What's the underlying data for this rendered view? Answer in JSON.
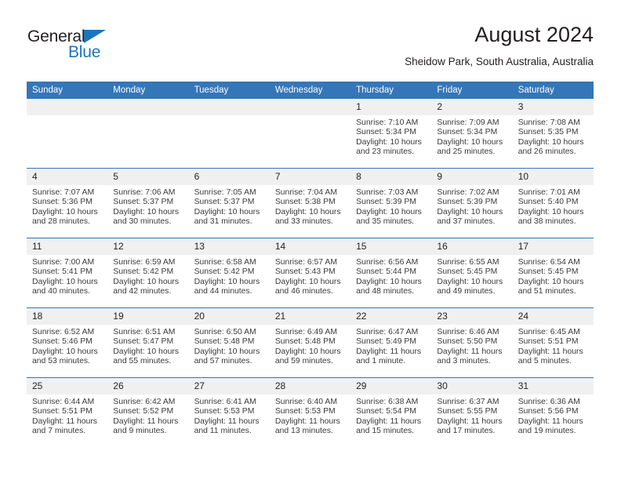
{
  "brand": {
    "name_dark": "General",
    "name_blue": "Blue",
    "accent_color": "#1b75bc"
  },
  "header": {
    "title": "August 2024",
    "subtitle": "Sheidow Park, South Australia, Australia"
  },
  "theme": {
    "header_band": "#3576b8",
    "daynum_band": "#f0f0f0",
    "text": "#231f20"
  },
  "weekday_headers": [
    "Sunday",
    "Monday",
    "Tuesday",
    "Wednesday",
    "Thursday",
    "Friday",
    "Saturday"
  ],
  "weeks": [
    [
      {
        "day": "",
        "blank": true
      },
      {
        "day": "",
        "blank": true
      },
      {
        "day": "",
        "blank": true
      },
      {
        "day": "",
        "blank": true
      },
      {
        "day": "1",
        "sunrise": "Sunrise: 7:10 AM",
        "sunset": "Sunset: 5:34 PM",
        "daylight": "Daylight: 10 hours and 23 minutes."
      },
      {
        "day": "2",
        "sunrise": "Sunrise: 7:09 AM",
        "sunset": "Sunset: 5:34 PM",
        "daylight": "Daylight: 10 hours and 25 minutes."
      },
      {
        "day": "3",
        "sunrise": "Sunrise: 7:08 AM",
        "sunset": "Sunset: 5:35 PM",
        "daylight": "Daylight: 10 hours and 26 minutes."
      }
    ],
    [
      {
        "day": "4",
        "sunrise": "Sunrise: 7:07 AM",
        "sunset": "Sunset: 5:36 PM",
        "daylight": "Daylight: 10 hours and 28 minutes."
      },
      {
        "day": "5",
        "sunrise": "Sunrise: 7:06 AM",
        "sunset": "Sunset: 5:37 PM",
        "daylight": "Daylight: 10 hours and 30 minutes."
      },
      {
        "day": "6",
        "sunrise": "Sunrise: 7:05 AM",
        "sunset": "Sunset: 5:37 PM",
        "daylight": "Daylight: 10 hours and 31 minutes."
      },
      {
        "day": "7",
        "sunrise": "Sunrise: 7:04 AM",
        "sunset": "Sunset: 5:38 PM",
        "daylight": "Daylight: 10 hours and 33 minutes."
      },
      {
        "day": "8",
        "sunrise": "Sunrise: 7:03 AM",
        "sunset": "Sunset: 5:39 PM",
        "daylight": "Daylight: 10 hours and 35 minutes."
      },
      {
        "day": "9",
        "sunrise": "Sunrise: 7:02 AM",
        "sunset": "Sunset: 5:39 PM",
        "daylight": "Daylight: 10 hours and 37 minutes."
      },
      {
        "day": "10",
        "sunrise": "Sunrise: 7:01 AM",
        "sunset": "Sunset: 5:40 PM",
        "daylight": "Daylight: 10 hours and 38 minutes."
      }
    ],
    [
      {
        "day": "11",
        "sunrise": "Sunrise: 7:00 AM",
        "sunset": "Sunset: 5:41 PM",
        "daylight": "Daylight: 10 hours and 40 minutes."
      },
      {
        "day": "12",
        "sunrise": "Sunrise: 6:59 AM",
        "sunset": "Sunset: 5:42 PM",
        "daylight": "Daylight: 10 hours and 42 minutes."
      },
      {
        "day": "13",
        "sunrise": "Sunrise: 6:58 AM",
        "sunset": "Sunset: 5:42 PM",
        "daylight": "Daylight: 10 hours and 44 minutes."
      },
      {
        "day": "14",
        "sunrise": "Sunrise: 6:57 AM",
        "sunset": "Sunset: 5:43 PM",
        "daylight": "Daylight: 10 hours and 46 minutes."
      },
      {
        "day": "15",
        "sunrise": "Sunrise: 6:56 AM",
        "sunset": "Sunset: 5:44 PM",
        "daylight": "Daylight: 10 hours and 48 minutes."
      },
      {
        "day": "16",
        "sunrise": "Sunrise: 6:55 AM",
        "sunset": "Sunset: 5:45 PM",
        "daylight": "Daylight: 10 hours and 49 minutes."
      },
      {
        "day": "17",
        "sunrise": "Sunrise: 6:54 AM",
        "sunset": "Sunset: 5:45 PM",
        "daylight": "Daylight: 10 hours and 51 minutes."
      }
    ],
    [
      {
        "day": "18",
        "sunrise": "Sunrise: 6:52 AM",
        "sunset": "Sunset: 5:46 PM",
        "daylight": "Daylight: 10 hours and 53 minutes."
      },
      {
        "day": "19",
        "sunrise": "Sunrise: 6:51 AM",
        "sunset": "Sunset: 5:47 PM",
        "daylight": "Daylight: 10 hours and 55 minutes."
      },
      {
        "day": "20",
        "sunrise": "Sunrise: 6:50 AM",
        "sunset": "Sunset: 5:48 PM",
        "daylight": "Daylight: 10 hours and 57 minutes."
      },
      {
        "day": "21",
        "sunrise": "Sunrise: 6:49 AM",
        "sunset": "Sunset: 5:48 PM",
        "daylight": "Daylight: 10 hours and 59 minutes."
      },
      {
        "day": "22",
        "sunrise": "Sunrise: 6:47 AM",
        "sunset": "Sunset: 5:49 PM",
        "daylight": "Daylight: 11 hours and 1 minute."
      },
      {
        "day": "23",
        "sunrise": "Sunrise: 6:46 AM",
        "sunset": "Sunset: 5:50 PM",
        "daylight": "Daylight: 11 hours and 3 minutes."
      },
      {
        "day": "24",
        "sunrise": "Sunrise: 6:45 AM",
        "sunset": "Sunset: 5:51 PM",
        "daylight": "Daylight: 11 hours and 5 minutes."
      }
    ],
    [
      {
        "day": "25",
        "sunrise": "Sunrise: 6:44 AM",
        "sunset": "Sunset: 5:51 PM",
        "daylight": "Daylight: 11 hours and 7 minutes."
      },
      {
        "day": "26",
        "sunrise": "Sunrise: 6:42 AM",
        "sunset": "Sunset: 5:52 PM",
        "daylight": "Daylight: 11 hours and 9 minutes."
      },
      {
        "day": "27",
        "sunrise": "Sunrise: 6:41 AM",
        "sunset": "Sunset: 5:53 PM",
        "daylight": "Daylight: 11 hours and 11 minutes."
      },
      {
        "day": "28",
        "sunrise": "Sunrise: 6:40 AM",
        "sunset": "Sunset: 5:53 PM",
        "daylight": "Daylight: 11 hours and 13 minutes."
      },
      {
        "day": "29",
        "sunrise": "Sunrise: 6:38 AM",
        "sunset": "Sunset: 5:54 PM",
        "daylight": "Daylight: 11 hours and 15 minutes."
      },
      {
        "day": "30",
        "sunrise": "Sunrise: 6:37 AM",
        "sunset": "Sunset: 5:55 PM",
        "daylight": "Daylight: 11 hours and 17 minutes."
      },
      {
        "day": "31",
        "sunrise": "Sunrise: 6:36 AM",
        "sunset": "Sunset: 5:56 PM",
        "daylight": "Daylight: 11 hours and 19 minutes."
      }
    ]
  ]
}
